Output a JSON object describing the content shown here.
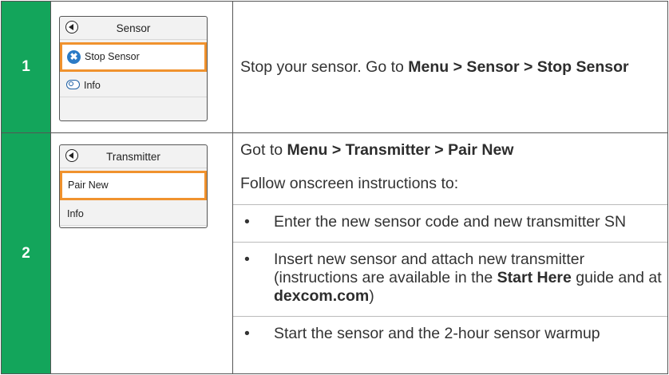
{
  "steps": [
    {
      "number": "1",
      "device": {
        "title": "Sensor",
        "items": [
          {
            "label": "Stop Sensor",
            "icon": "stop-icon",
            "selected": true
          },
          {
            "label": "Info",
            "icon": "info-icon",
            "selected": false
          }
        ]
      },
      "text": {
        "t1": "Stop your sensor. Go to ",
        "b1": "Menu > Sensor > Stop Sensor"
      }
    },
    {
      "number": "2",
      "device": {
        "title": "Transmitter",
        "items": [
          {
            "label": "Pair New",
            "selected": true
          },
          {
            "label": "Info",
            "selected": false
          }
        ]
      },
      "text": {
        "line1_t": "Got to ",
        "line1_b": "Menu > Transmitter > Pair New",
        "line2": "Follow onscreen instructions to:",
        "bullet_char": "•",
        "bullet1": "Enter the new sensor code and new transmitter SN",
        "bullet2_t1": "Insert new sensor and attach new transmitter (instructions are available in the ",
        "bullet2_b1": "Start Here",
        "bullet2_t2": " guide and at ",
        "bullet2_b2": "dexcom.com",
        "bullet2_t3": ")",
        "bullet3": "Start the sensor and the 2-hour sensor warmup"
      }
    }
  ],
  "colors": {
    "step_green": "#13a55b",
    "highlight_orange": "#f0922e",
    "icon_blue": "#2b7bc6"
  }
}
